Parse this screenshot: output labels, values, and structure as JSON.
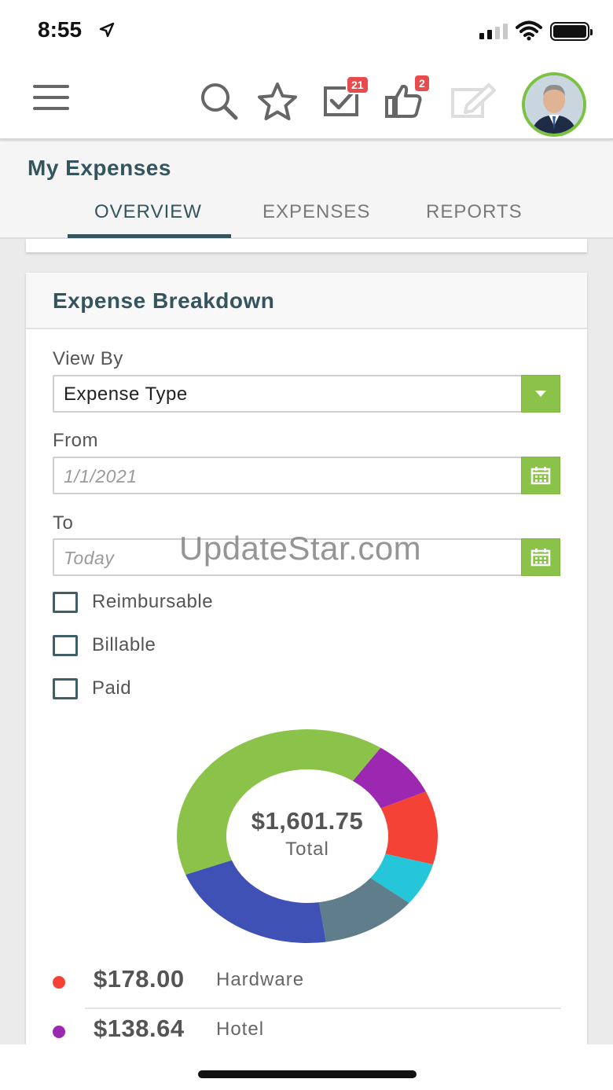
{
  "status_bar": {
    "time": "8:55"
  },
  "app_bar": {
    "tasks_badge": "21",
    "approvals_badge": "2"
  },
  "page": {
    "title": "My Expenses",
    "tabs": [
      {
        "label": "OVERVIEW",
        "active": true
      },
      {
        "label": "EXPENSES",
        "active": false
      },
      {
        "label": "REPORTS",
        "active": false
      }
    ]
  },
  "breakdown": {
    "title": "Expense Breakdown",
    "view_by_label": "View By",
    "view_by_value": "Expense Type",
    "from_label": "From",
    "from_value": "1/1/2021",
    "to_label": "To",
    "to_placeholder": "Today",
    "checkboxes": [
      {
        "label": "Reimbursable",
        "checked": false
      },
      {
        "label": "Billable",
        "checked": false
      },
      {
        "label": "Paid",
        "checked": false
      }
    ],
    "total_amount": "$1,601.75",
    "total_label": "Total",
    "legend": [
      {
        "amount": "$178.00",
        "name": "Hardware",
        "color": "#f44336"
      },
      {
        "amount": "$138.64",
        "name": "Hotel",
        "color": "#9c27b0"
      }
    ]
  },
  "chart_data": {
    "type": "pie",
    "total": 1601.75,
    "slices": [
      {
        "value": 138.64,
        "color": "#9c27b0"
      },
      {
        "value": 178.0,
        "color": "#f44336"
      },
      {
        "color": "#26c6da"
      },
      {
        "color": "#607d8b"
      },
      {
        "color": "#3f51b5"
      },
      {
        "color": "#8bc34a"
      }
    ]
  },
  "watermark": "UpdateStar.com",
  "colors": {
    "accent": "#34545e",
    "green": "#8bc34a",
    "badge": "#e84b4b"
  }
}
